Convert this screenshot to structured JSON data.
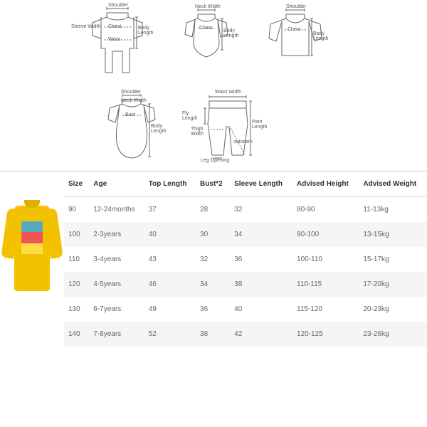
{
  "diagrams": {
    "romper": {
      "shoulder": "Shoulder",
      "sleeve_width": "Sleeve Width",
      "chest": "Chest",
      "waist": "Waist",
      "body_length": "Body Length"
    },
    "onesie": {
      "neck_width": "Neck Width",
      "chest": "Chest",
      "body_length": "Body Length"
    },
    "shirt": {
      "shoulder": "Shoulder",
      "chest": "Chest",
      "body_length": "Body Length"
    },
    "dress": {
      "shoulder": "Shoulder",
      "neck_width": "Neck Width",
      "bust": "Bust",
      "body_length": "Body Length"
    },
    "pants": {
      "waist_width": "Waist Width",
      "fly_length": "Fly Length",
      "thigh_width": "Thigh Width",
      "leg_opening": "Leg Opening",
      "pant_length": "Pant Length",
      "outseam": "outseam"
    }
  },
  "table": {
    "headers": [
      "Size",
      "Age",
      "Top Length",
      "Bust*2",
      "Sleeve Length",
      "Advised Height",
      "Advised Weight"
    ],
    "rows": [
      [
        "90",
        "12-24months",
        "37",
        "28",
        "32",
        "80-90",
        "11-13kg"
      ],
      [
        "100",
        "2-3years",
        "40",
        "30",
        "34",
        "90-100",
        "13-15kg"
      ],
      [
        "110",
        "3-4years",
        "43",
        "32",
        "36",
        "100-110",
        "15-17kg"
      ],
      [
        "120",
        "4-5years",
        "46",
        "34",
        "38",
        "110-115",
        "17-20kg"
      ],
      [
        "130",
        "6-7years",
        "49",
        "36",
        "40",
        "115-120",
        "20-23kg"
      ],
      [
        "140",
        "7-8years",
        "52",
        "38",
        "42",
        "120-125",
        "23-26kg"
      ]
    ]
  }
}
